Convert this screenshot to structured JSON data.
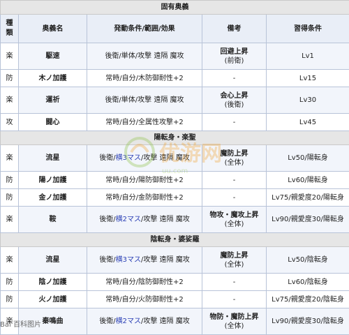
{
  "sections": {
    "s1": "固有奥義",
    "s2": "陽転身・楽聖",
    "s3": "陰転身・婆娑羅"
  },
  "headers": {
    "kind_line1": "種",
    "kind_line2": "類",
    "name": "奥義名",
    "cond": "発動条件/範囲/効果",
    "remark": "備考",
    "learn": "習得条件"
  },
  "group1": [
    {
      "cat": "楽",
      "name": "駆速",
      "cond": "後衛/単体/攻撃 遠隔 魔攻",
      "remark1": "回避上昇",
      "remark2": "(前衛)",
      "learn": "Lv1"
    },
    {
      "cat": "防",
      "name": "木ノ加護",
      "cond": "常時/自分/木防御耐性+2",
      "remark1": "-",
      "remark2": "",
      "learn": "Lv15"
    },
    {
      "cat": "楽",
      "name": "運祈",
      "cond": "後衛/単体/攻撃 遠隔 魔攻",
      "remark1": "会心上昇",
      "remark2": "(後衛)",
      "learn": "Lv30"
    },
    {
      "cat": "攻",
      "name": "闘心",
      "cond": "常時/自分/全属性攻撃+2",
      "remark1": "-",
      "remark2": "",
      "learn": "Lv45"
    }
  ],
  "group2": [
    {
      "cat": "楽",
      "name": "流星",
      "cond_a": "後衛/",
      "cond_b": "横3マス",
      "cond_c": "/攻撃 遠隔 魔攻",
      "remark1": "魔防上昇",
      "remark2": "(全体)",
      "learn": "Lv50/陽転身"
    },
    {
      "cat": "防",
      "name": "陽ノ加護",
      "cond": "常時/自分/陽防御耐性+2",
      "remark1": "-",
      "remark2": "",
      "learn": "Lv60/陽転身"
    },
    {
      "cat": "防",
      "name": "金ノ加護",
      "cond": "常時/自分/金防御耐性+2",
      "remark1": "-",
      "remark2": "",
      "learn": "Lv75/親愛度20/陽転身"
    },
    {
      "cat": "楽",
      "name": "鞍",
      "cond_a": "後衛/",
      "cond_b": "横2マス",
      "cond_c": "/攻撃 遠隔 魔攻",
      "remark1": "物攻・魔攻上昇",
      "remark2": "(全体)",
      "learn": "Lv90/親愛度30/陽転身"
    }
  ],
  "group3": [
    {
      "cat": "楽",
      "name": "流星",
      "cond_a": "後衛/",
      "cond_b": "横3マス",
      "cond_c": "/攻撃 遠隔 魔攻",
      "remark1": "魔防上昇",
      "remark2": "(全体)",
      "learn": "Lv50/陰転身"
    },
    {
      "cat": "防",
      "name": "陰ノ加護",
      "cond": "常時/自分/陰防御耐性+2",
      "remark1": "-",
      "remark2": "",
      "learn": "Lv60/陰転身"
    },
    {
      "cat": "防",
      "name": "火ノ加護",
      "cond": "常時/自分/火防御耐性+2",
      "remark1": "-",
      "remark2": "",
      "learn": "Lv75/親愛度20/陰転身"
    },
    {
      "cat": "楽",
      "name": "秦鳴曲",
      "cond_a": "後衛/",
      "cond_b": "横2マス",
      "cond_c": "/攻撃 遠隔 魔攻",
      "remark1": "物防・魔防上昇",
      "remark2": "(全体)",
      "learn": "Lv90/親愛度30/陰転身"
    }
  ],
  "watermark": {
    "text": "优游网",
    "sub": "uu.com"
  },
  "footer": {
    "text": "Bai 百科图片"
  },
  "colors": {
    "border": "#b8c3d8",
    "header_bg": "#e9eef7",
    "section_bg": "#e6e6e6",
    "alt_row_bg": "#f2f5fb",
    "link_blue": "#2a3fb5"
  }
}
